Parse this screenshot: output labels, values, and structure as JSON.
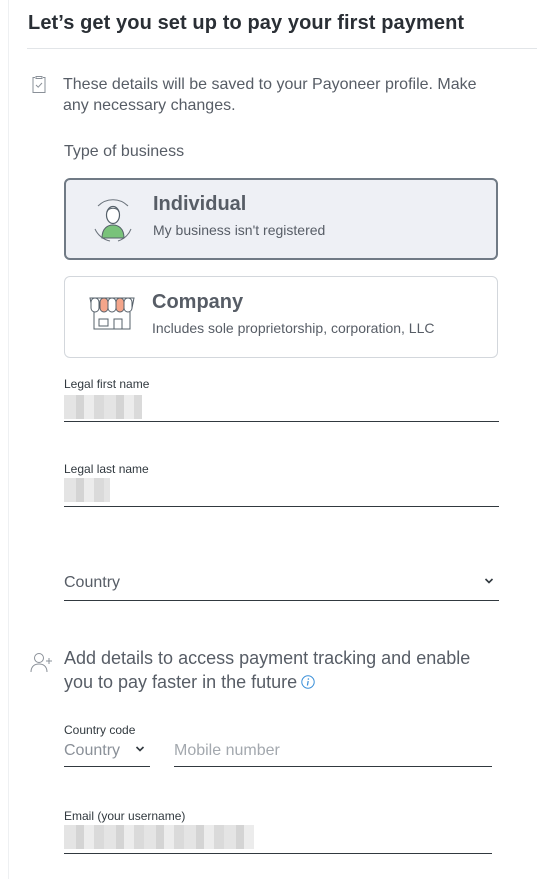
{
  "header": {
    "title": "Let’s get you set up to pay your first payment"
  },
  "notice": {
    "text": "These details will be saved to your Payoneer profile. Make any necessary changes."
  },
  "business_type": {
    "label": "Type of business",
    "options": [
      {
        "title": "Individual",
        "subtitle": "My business isn't registered",
        "selected": true
      },
      {
        "title": "Company",
        "subtitle": "Includes sole proprietorship, corporation, LLC",
        "selected": false
      }
    ]
  },
  "fields": {
    "first_name": {
      "label": "Legal first name"
    },
    "last_name": {
      "label": "Legal last name"
    },
    "country": {
      "placeholder": "Country"
    }
  },
  "tracking": {
    "text": "Add details to access payment tracking and enable you to pay faster in the future"
  },
  "phone": {
    "country_code_label": "Country code",
    "country_code_placeholder": "Country",
    "mobile_placeholder": "Mobile number"
  },
  "email": {
    "label": "Email (your username)"
  },
  "colors": {
    "text": "#31393f",
    "muted": "#575d66",
    "selected_bg": "#eef0f5",
    "selected_border": "#707a85",
    "avatar_green": "#79c27a",
    "awning_orange": "#f4a58a",
    "info_blue": "#3a8fd8"
  },
  "icons": {
    "notice": "clipboard-check-icon",
    "individual": "person-avatar-icon",
    "company": "storefront-icon",
    "chevron": "chevron-down-icon",
    "add_user": "add-user-icon",
    "info": "info-icon"
  }
}
